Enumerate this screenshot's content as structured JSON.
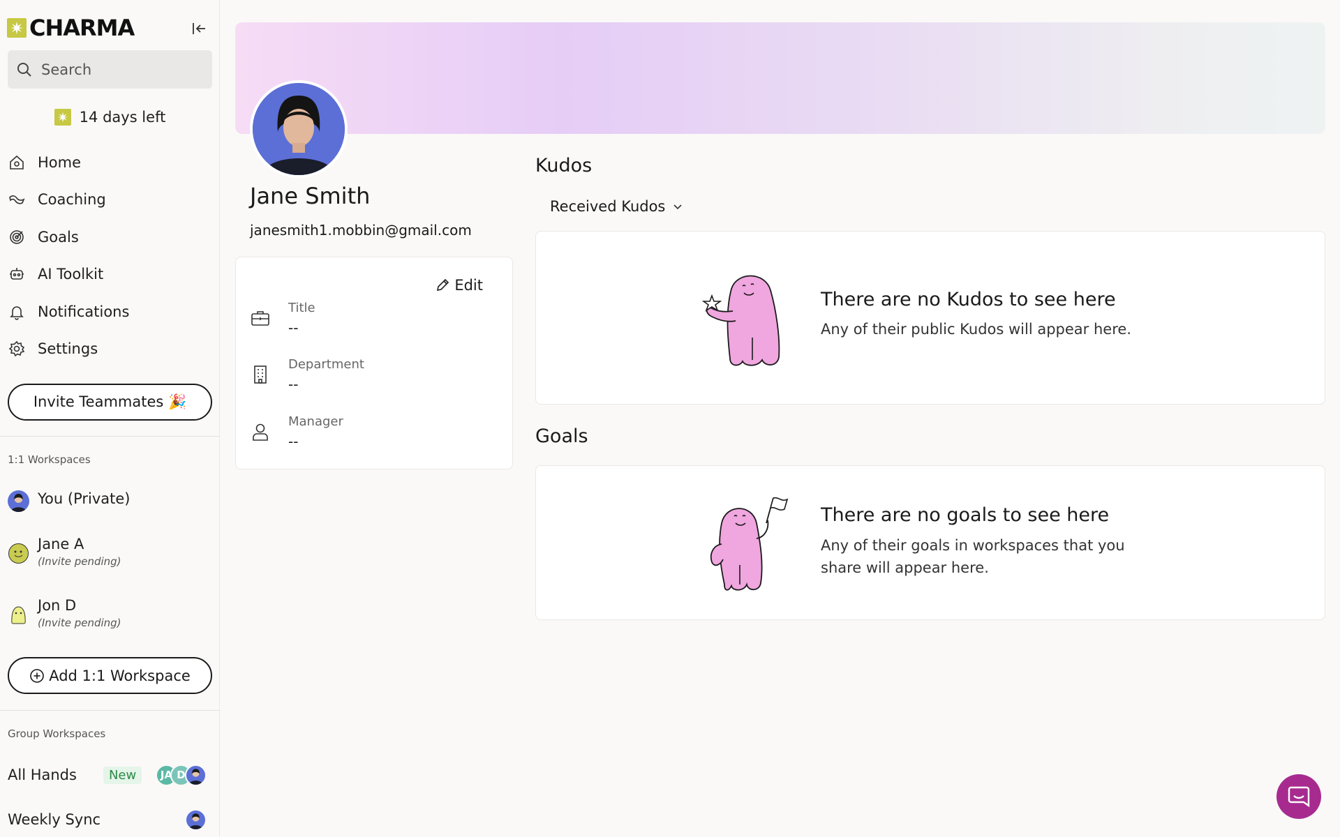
{
  "app": {
    "brand": "CHARMA"
  },
  "sidebar": {
    "search_placeholder": "Search",
    "trial": "14 days left",
    "nav": [
      {
        "label": "Home",
        "icon": "home-icon"
      },
      {
        "label": "Coaching",
        "icon": "coaching-icon"
      },
      {
        "label": "Goals",
        "icon": "goals-icon"
      },
      {
        "label": "AI Toolkit",
        "icon": "robot-icon"
      },
      {
        "label": "Notifications",
        "icon": "bell-icon"
      },
      {
        "label": "Settings",
        "icon": "gear-icon"
      }
    ],
    "invite_label": "Invite Teammates 🎉",
    "one_on_one_label": "1:1 Workspaces",
    "workspaces": [
      {
        "name": "You (Private)",
        "sub": ""
      },
      {
        "name": "Jane A",
        "sub": "(Invite pending)"
      },
      {
        "name": "Jon D",
        "sub": "(Invite pending)"
      }
    ],
    "add_workspace_label": "Add 1:1 Workspace",
    "group_label": "Group Workspaces",
    "groups": [
      {
        "name": "All Hands",
        "badge": "New",
        "avatars": [
          "JA",
          "D"
        ]
      },
      {
        "name": "Weekly Sync"
      }
    ]
  },
  "profile": {
    "name": "Jane Smith",
    "email": "janesmith1.mobbin@gmail.com",
    "edit_label": "Edit",
    "fields": [
      {
        "label": "Title",
        "value": "--"
      },
      {
        "label": "Department",
        "value": "--"
      },
      {
        "label": "Manager",
        "value": "--"
      }
    ]
  },
  "kudos": {
    "title": "Kudos",
    "filter": "Received Kudos",
    "empty_title": "There are no Kudos to see here",
    "empty_desc": "Any of their public Kudos will appear here."
  },
  "goals": {
    "title": "Goals",
    "empty_title": "There are no goals to see here",
    "empty_desc": "Any of their goals in workspaces that you share will appear here."
  },
  "colors": {
    "accent": "#a72b8f",
    "brand": "#c7c843",
    "illustration": "#f0a6df"
  }
}
